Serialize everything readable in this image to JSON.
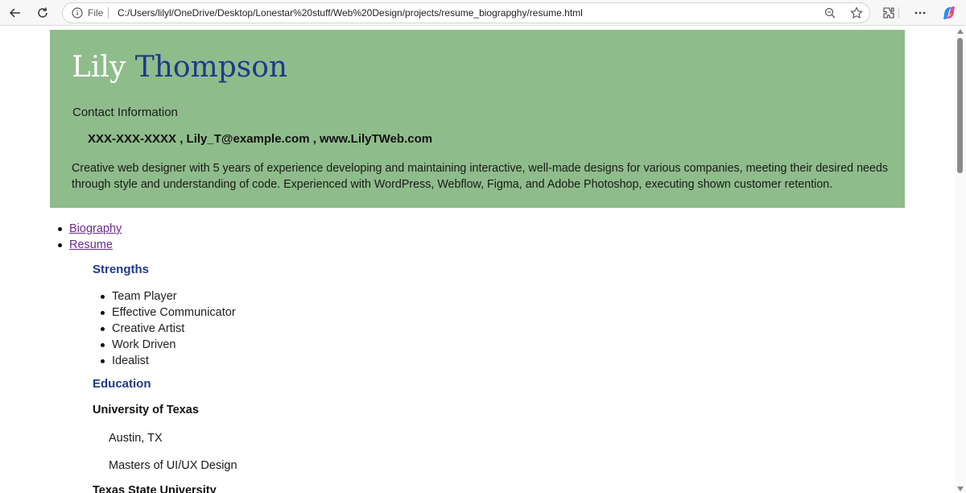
{
  "browser": {
    "file_label": "File",
    "url": "C:/Users/lilyl/OneDrive/Desktop/Lonestar%20stuff/Web%20Design/projects/resume_biograpghy/resume.html",
    "icons": [
      "back-icon",
      "refresh-icon",
      "info-icon",
      "zoom-icon",
      "favorite-star-icon",
      "extensions-icon",
      "more-icon",
      "copilot-icon"
    ]
  },
  "header": {
    "first_name": "Lily",
    "last_name": "Thompson",
    "contact_label": "Contact Information",
    "contact_line": "XXX-XXX-XXXX , Lily_T@example.com , www.LilyTWeb.com",
    "summary": "Creative web designer with 5 years of experience developing and maintaining interactive, well-made designs for various companies, meeting their desired needs through style and understanding of code. Experienced with WordPress, Webflow, Figma, and Adobe Photoshop, executing shown customer retention."
  },
  "nav": {
    "items": [
      {
        "label": "Biography"
      },
      {
        "label": "Resume"
      }
    ]
  },
  "strengths": {
    "title": "Strengths",
    "items": [
      "Team Player",
      "Effective Communicator",
      "Creative Artist",
      "Work Driven",
      "Idealist"
    ]
  },
  "education": {
    "title": "Education",
    "schools": [
      {
        "name": "University of Texas",
        "location": "Austin, TX",
        "degree": "Masters of UI/UX Design"
      },
      {
        "name": "Texas State University"
      }
    ]
  },
  "colors": {
    "header_bg": "#8fbc8b",
    "accent_blue": "#1f3a8a",
    "link_visited": "#6a2c8c"
  }
}
